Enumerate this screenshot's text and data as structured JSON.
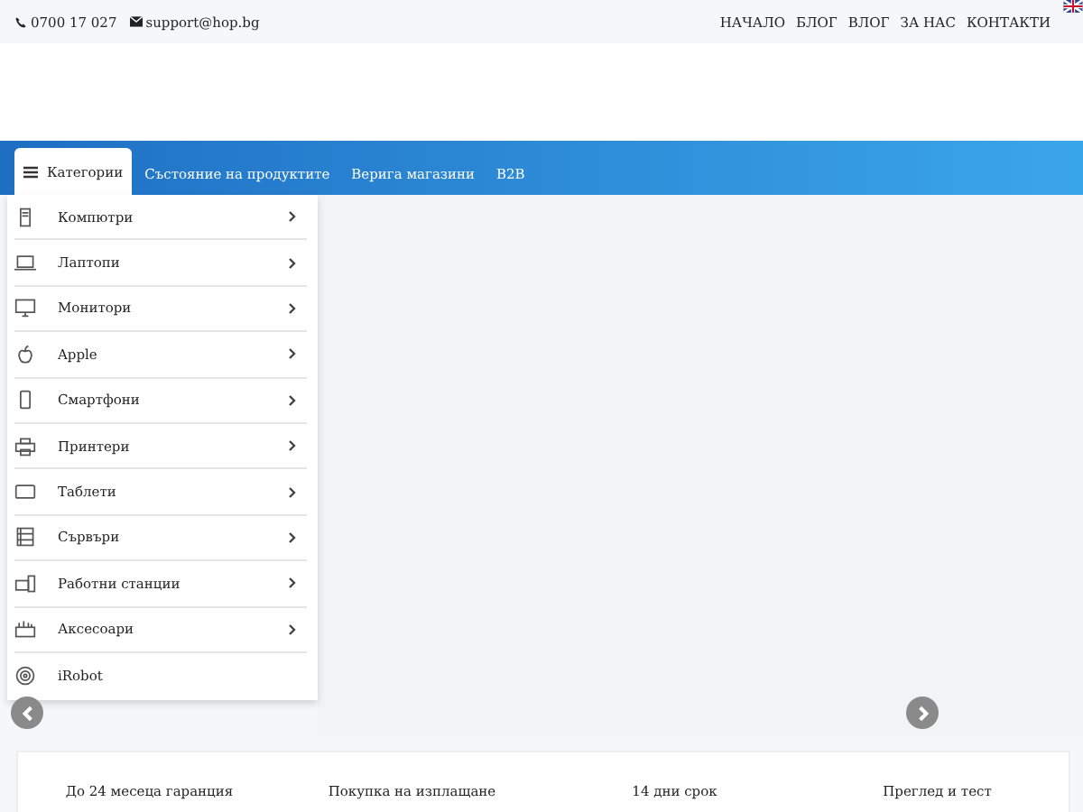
{
  "topbar": {
    "phone": "0700 17 027",
    "email": "support@hop.bg",
    "links": [
      "НАЧАЛО",
      "БЛОГ",
      "ВЛОГ",
      "ЗА НАС",
      "КОНТАКТИ"
    ]
  },
  "nav": {
    "tabs": [
      {
        "label": "Категории",
        "selected": true
      },
      {
        "label": "Състояние на продуктите",
        "selected": false
      },
      {
        "label": "Верига магазини",
        "selected": false
      },
      {
        "label": "B2B",
        "selected": false
      }
    ]
  },
  "categories": [
    {
      "label": "Компютри",
      "kind": "tower",
      "has_submenu": true
    },
    {
      "label": "Лаптопи",
      "kind": "laptop",
      "has_submenu": true
    },
    {
      "label": "Монитори",
      "kind": "monitor",
      "has_submenu": true
    },
    {
      "label": "Apple",
      "kind": "apple",
      "has_submenu": true
    },
    {
      "label": "Смартфони",
      "kind": "phone",
      "has_submenu": true
    },
    {
      "label": "Принтери",
      "kind": "printer",
      "has_submenu": true
    },
    {
      "label": "Таблети",
      "kind": "tablet",
      "has_submenu": true
    },
    {
      "label": "Сървъри",
      "kind": "server",
      "has_submenu": true
    },
    {
      "label": "Работни станции",
      "kind": "workstation",
      "has_submenu": true
    },
    {
      "label": "Аксесоари",
      "kind": "accessory",
      "has_submenu": true
    },
    {
      "label": "iRobot",
      "kind": "robot",
      "has_submenu": false
    }
  ],
  "features": [
    {
      "title": "До 24 месеца гаранция"
    },
    {
      "title": "Покупка на изплащане"
    },
    {
      "title": "14 дни срок"
    },
    {
      "title": "Преглед и тест"
    }
  ]
}
